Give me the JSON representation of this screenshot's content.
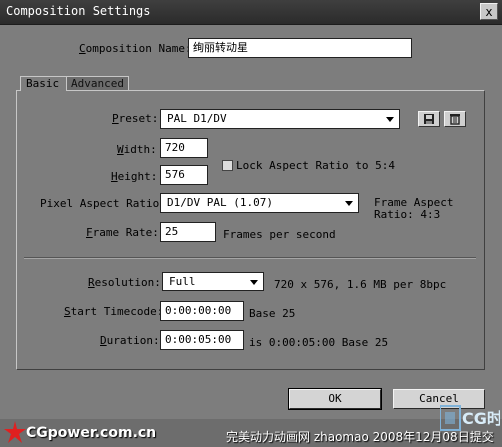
{
  "window": {
    "title": "Composition Settings",
    "close_glyph": "x"
  },
  "composition_name": {
    "label_u": "C",
    "label": "omposition Name:",
    "value": "绚丽转动星"
  },
  "tabs": [
    {
      "label": "Basic",
      "active": true
    },
    {
      "label": "Advanced",
      "active": false
    }
  ],
  "preset": {
    "label_u": "P",
    "label": "reset:",
    "value": "PAL D1/DV",
    "icons": [
      "save-icon",
      "trash-icon"
    ]
  },
  "width": {
    "label_u": "W",
    "label": "idth:",
    "value": "720"
  },
  "height": {
    "label_u": "H",
    "label": "eight:",
    "value": "576"
  },
  "lock_aspect": {
    "label": "Lock Aspect Ratio to 5:4",
    "checked": false
  },
  "pixel_aspect": {
    "label": "Pixel Aspect Ratio:",
    "value": "D1/DV PAL (1.07)",
    "frame_aspect_line1": "Frame Aspect",
    "frame_aspect_line2": "Ratio: 4:3"
  },
  "frame_rate": {
    "label_u": "F",
    "label": "rame Rate:",
    "value": "25",
    "unit": "Frames per second"
  },
  "resolution": {
    "label_u": "R",
    "label": "esolution:",
    "value": "Full",
    "info": "720 x 576, 1.6 MB per 8bpc"
  },
  "start_timecode": {
    "label_u": "S",
    "label": "tart Timecode:",
    "value": "0:00:00:00",
    "base": "Base 25"
  },
  "duration": {
    "label_u": "D",
    "label": "uration:",
    "value": "0:00:05:00",
    "info": "is 0:00:05:00  Base 25"
  },
  "buttons": {
    "ok": "OK",
    "cancel": "Cancel"
  },
  "watermark": {
    "site": "CGpower.com.cn",
    "caption": "完美动力动画网 zhaomao 2008年12月08日提交",
    "brand": "CG时代"
  },
  "colors": {
    "dialog_bg": "#7d7d7d",
    "titlebar": "#2b2b2b",
    "field_bg": "#ffffff"
  }
}
